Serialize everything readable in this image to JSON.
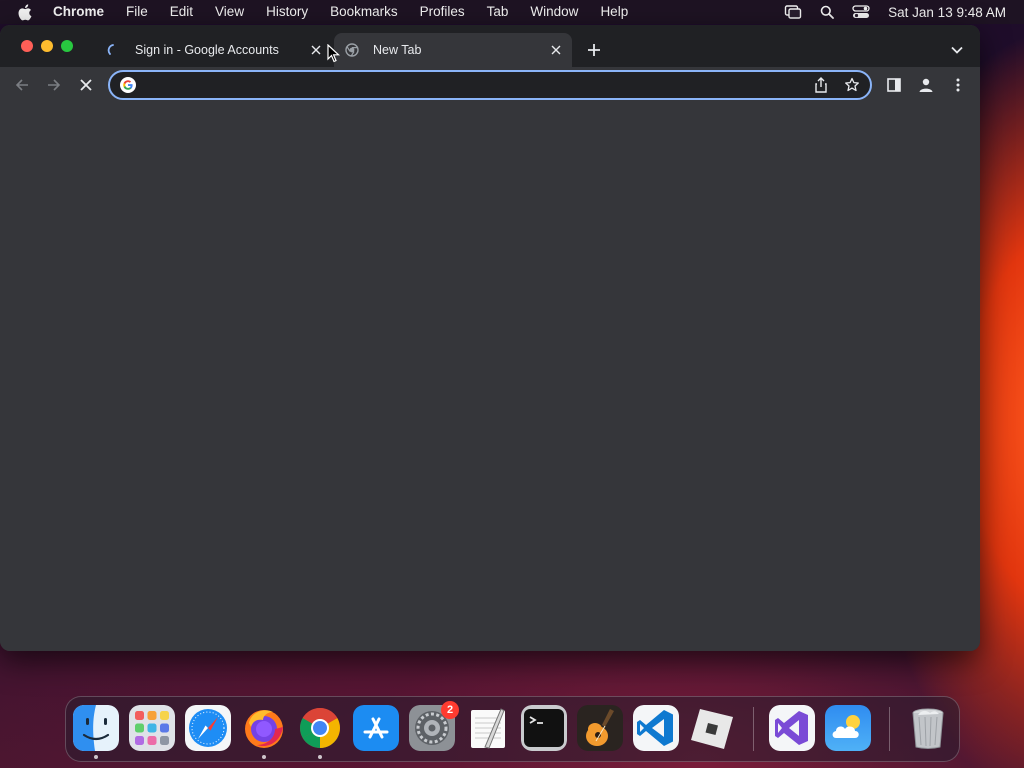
{
  "menubar": {
    "app_name": "Chrome",
    "items": [
      "File",
      "Edit",
      "View",
      "History",
      "Bookmarks",
      "Profiles",
      "Tab",
      "Window",
      "Help"
    ],
    "clock": "Sat Jan 13  9:48 AM",
    "status_icons": [
      "screen-mirroring-icon",
      "spotlight-search-icon",
      "control-center-icon"
    ]
  },
  "browser": {
    "tabs": [
      {
        "title": "Sign in - Google Accounts",
        "favicon": "loading-spinner-icon",
        "active": false
      },
      {
        "title": "New Tab",
        "favicon": "chrome-newtab-icon",
        "active": true
      }
    ],
    "omnibox": {
      "value": "",
      "placeholder": ""
    },
    "toolbar_icons": [
      "back-icon",
      "forward-icon",
      "stop-loading-icon",
      "share-icon",
      "bookmark-star-icon",
      "side-panel-icon",
      "profile-icon",
      "menu-icon"
    ]
  },
  "dock": {
    "apps": [
      {
        "name": "Finder",
        "running": true
      },
      {
        "name": "Launchpad",
        "running": false
      },
      {
        "name": "Safari",
        "running": false
      },
      {
        "name": "Firefox",
        "running": true
      },
      {
        "name": "Google Chrome",
        "running": true
      },
      {
        "name": "App Store",
        "running": false
      },
      {
        "name": "System Settings",
        "running": false,
        "badge": "2"
      },
      {
        "name": "TextEdit",
        "running": false
      },
      {
        "name": "Terminal",
        "running": false
      },
      {
        "name": "GarageBand",
        "running": false
      },
      {
        "name": "Visual Studio Code",
        "running": false
      },
      {
        "name": "Roblox",
        "running": false
      },
      {
        "name": "Visual Studio",
        "running": false
      },
      {
        "name": "Weather",
        "running": false
      },
      {
        "name": "Trash",
        "running": false
      }
    ]
  },
  "colors": {
    "window_bg": "#35363a",
    "tabstrip_bg": "#202124",
    "omnibox_focus": "#8ab4f8",
    "text": "#e8eaed"
  }
}
